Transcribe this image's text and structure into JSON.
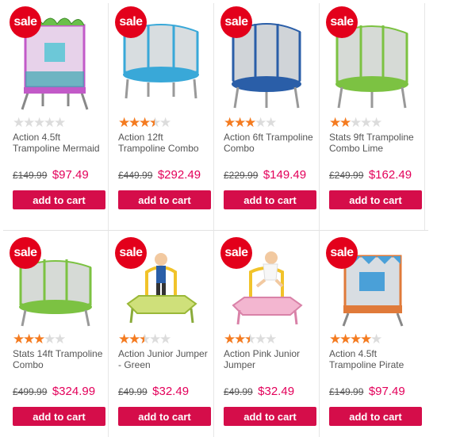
{
  "sale_badge": "sale",
  "add_to_cart_label": "add to cart",
  "colors": {
    "sale_red": "#e3001b",
    "price_pink": "#e3005a",
    "button": "#d50d4a",
    "star_orange": "#f47b20",
    "star_grey": "#dcdcdc"
  },
  "products": [
    {
      "name": "Action 4.5ft Trampoline Mermaid",
      "rating": 0,
      "old_price": "£149.99",
      "new_price": "$97.49",
      "image": "mermaid-trampoline"
    },
    {
      "name": "Action 12ft Trampoline Combo",
      "rating": 3.5,
      "old_price": "£449.99",
      "new_price": "$292.49",
      "image": "12ft-trampoline"
    },
    {
      "name": "Action 6ft Trampoline Combo",
      "rating": 3,
      "old_price": "£229.99",
      "new_price": "$149.49",
      "image": "6ft-trampoline"
    },
    {
      "name": "Stats 9ft Trampoline Combo Lime",
      "rating": 2,
      "old_price": "£249.99",
      "new_price": "$162.49",
      "image": "9ft-lime-trampoline"
    },
    {
      "name": "Stats 14ft Trampoline Combo",
      "rating": 3,
      "old_price": "£499.99",
      "new_price": "$324.99",
      "image": "14ft-trampoline"
    },
    {
      "name": "Action Junior Jumper - Green",
      "rating": 2.5,
      "old_price": "£49.99",
      "new_price": "$32.49",
      "image": "junior-jumper-green"
    },
    {
      "name": "Action Pink Junior Jumper",
      "rating": 2.5,
      "old_price": "£49.99",
      "new_price": "$32.49",
      "image": "junior-jumper-pink"
    },
    {
      "name": "Action 4.5ft Trampoline Pirate",
      "rating": 4,
      "old_price": "£149.99",
      "new_price": "$97.49",
      "image": "pirate-trampoline"
    }
  ]
}
